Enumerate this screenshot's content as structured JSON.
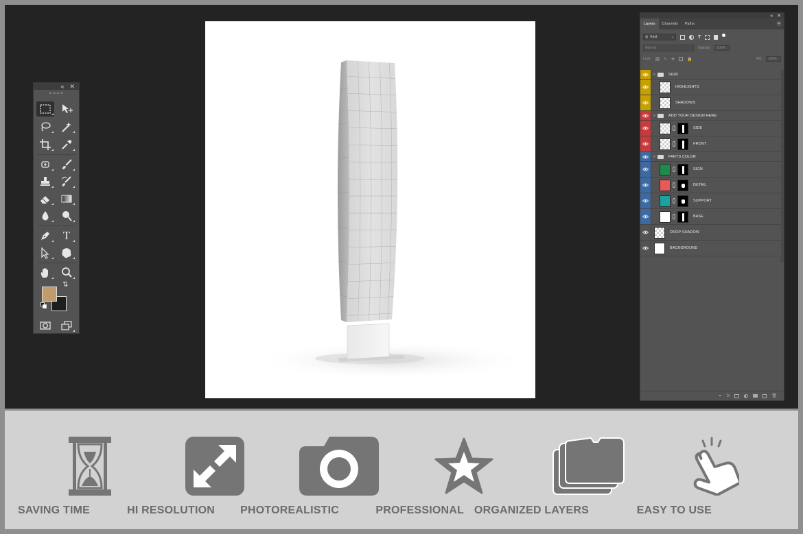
{
  "toolbar": {
    "header_icons": [
      "collapse-icon",
      "close-icon"
    ],
    "tools": [
      {
        "name": "rectangular-marquee-icon",
        "active": true
      },
      {
        "name": "move-icon"
      },
      {
        "name": "lasso-icon"
      },
      {
        "name": "magic-wand-icon"
      },
      {
        "name": "crop-icon"
      },
      {
        "name": "eyedropper-icon"
      },
      {
        "name": "healing-brush-icon"
      },
      {
        "name": "brush-icon"
      },
      {
        "name": "clone-stamp-icon"
      },
      {
        "name": "history-brush-icon"
      },
      {
        "name": "eraser-icon"
      },
      {
        "name": "gradient-icon"
      },
      {
        "name": "blur-icon"
      },
      {
        "name": "dodge-icon"
      },
      {
        "name": "pen-icon"
      },
      {
        "name": "type-icon"
      },
      {
        "name": "path-selection-icon"
      },
      {
        "name": "custom-shape-icon"
      },
      {
        "name": "hand-icon"
      },
      {
        "name": "zoom-icon"
      }
    ],
    "foreground_color": "#c19b6c",
    "background_color": "#1e1e1e",
    "type_tool_glyph": "T"
  },
  "layers_panel": {
    "tabs": [
      "Layers",
      "Channels",
      "Paths"
    ],
    "active_tab": "Layers",
    "filter_kind": "Kind",
    "blend_mode": "Normal",
    "opacity_label": "Opacity:",
    "opacity_value": "100%",
    "lock_label": "Lock:",
    "fill_label": "Fill:",
    "fill_value": "100%",
    "layers": [
      {
        "kind": "group",
        "name": "SIGN",
        "color": "#c8a000"
      },
      {
        "kind": "item",
        "name": "HIGHLIGHTS",
        "color": "#c8a000",
        "thumb": "checker",
        "mask": false
      },
      {
        "kind": "item",
        "name": "SHADOWS",
        "color": "#c8a000",
        "thumb": "checker",
        "mask": false
      },
      {
        "kind": "group",
        "name": "ADD YOUR DESIGN HERE",
        "color": "#c93a3a"
      },
      {
        "kind": "item",
        "name": "SIDE",
        "color": "#c93a3a",
        "thumb": "checker",
        "mask": true
      },
      {
        "kind": "item",
        "name": "FRONT",
        "color": "#c93a3a",
        "thumb": "checker",
        "mask": true
      },
      {
        "kind": "group",
        "name": "PARTS COLOR",
        "color": "#3d6aa3"
      },
      {
        "kind": "item",
        "name": "SIGN",
        "color": "#3d6aa3",
        "thumb_color": "#1f8a4a",
        "mask": true
      },
      {
        "kind": "item",
        "name": "DETAIL",
        "color": "#3d6aa3",
        "thumb_color": "#e85a5a",
        "mask": true,
        "blob": true
      },
      {
        "kind": "item",
        "name": "SUPPORT",
        "color": "#3d6aa3",
        "thumb_color": "#1aa3a0",
        "mask": true,
        "blob": true
      },
      {
        "kind": "item",
        "name": "BASE",
        "color": "#3d6aa3",
        "thumb": "white",
        "mask": true
      },
      {
        "kind": "item",
        "name": "DROP SHADOW",
        "color": "",
        "thumb": "checker",
        "mask": false
      },
      {
        "kind": "item",
        "name": "BACKGROUND",
        "color": "",
        "thumb": "white",
        "mask": false
      }
    ],
    "footer_icons": [
      "link-icon",
      "fx-icon",
      "mask-icon",
      "adjustment-icon",
      "folder-icon",
      "new-layer-icon",
      "trash-icon"
    ]
  },
  "features": [
    {
      "label": "SAVING TIME",
      "icon": "hourglass-icon"
    },
    {
      "label": "HI RESOLUTION",
      "icon": "expand-icon"
    },
    {
      "label": "PHOTOREALISTIC",
      "icon": "camera-icon"
    },
    {
      "label": "PROFESSIONAL",
      "icon": "star-icon"
    },
    {
      "label": "ORGANIZED LAYERS",
      "icon": "layers-folder-icon"
    },
    {
      "label": "EASY TO USE",
      "icon": "tap-hand-icon"
    }
  ],
  "colors": {
    "workspace": "#232323",
    "panel": "#535353",
    "feature_icon": "#757575",
    "feature_text": "#6b6b6b"
  }
}
